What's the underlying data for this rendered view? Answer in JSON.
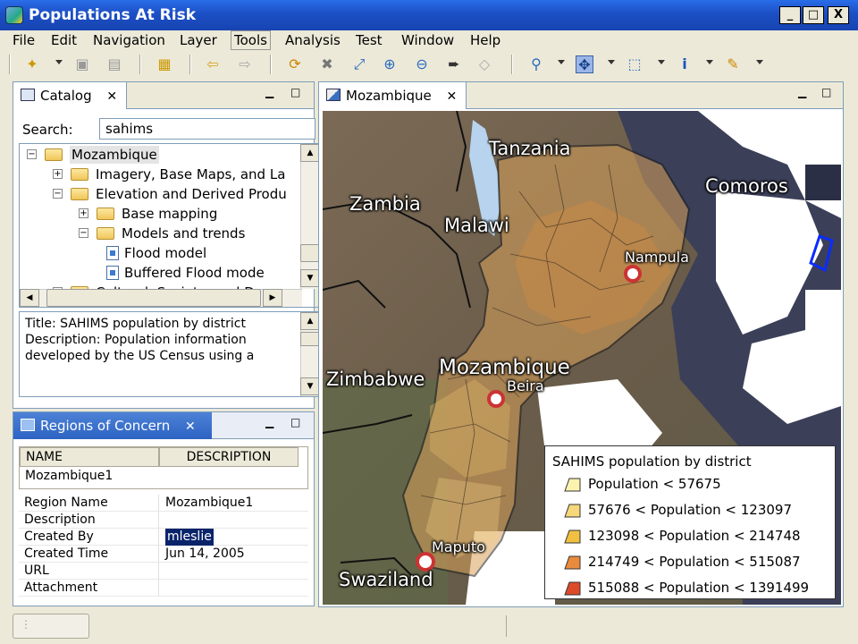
{
  "window": {
    "title": "Populations At Risk",
    "controls": [
      "_",
      "□",
      "X"
    ]
  },
  "menu": [
    "File",
    "Edit",
    "Navigation",
    "Layer",
    "Tools",
    "Analysis",
    "Test",
    "Window",
    "Help"
  ],
  "menu_active": "Tools",
  "catalog": {
    "tab_label": "Catalog",
    "search_label": "Search:",
    "search_value": "sahims",
    "tree": [
      {
        "label": "Mozambique",
        "level": 0,
        "type": "folder",
        "expanded": true,
        "selected": true
      },
      {
        "label": "Imagery, Base Maps, and La",
        "level": 1,
        "type": "folder",
        "expanded": false
      },
      {
        "label": "Elevation and Derived Produ",
        "level": 1,
        "type": "folder",
        "expanded": true
      },
      {
        "label": "Base mapping",
        "level": 2,
        "type": "folder",
        "expanded": false
      },
      {
        "label": "Models and trends",
        "level": 2,
        "type": "folder",
        "expanded": true
      },
      {
        "label": "Flood model",
        "level": 3,
        "type": "file"
      },
      {
        "label": "Buffered Flood mode",
        "level": 3,
        "type": "file"
      },
      {
        "label": "Cultural, Society, and Demo",
        "level": 1,
        "type": "folder",
        "expanded": true
      }
    ],
    "description_lines": [
      "Title: SAHIMS population by district",
      "Description: Population information",
      "developed by the US Census using a"
    ]
  },
  "regions": {
    "tab_label": "Regions of Concern",
    "columns": [
      "NAME",
      "DESCRIPTION"
    ],
    "rows": [
      {
        "name": "Mozambique1",
        "description": ""
      }
    ],
    "properties": [
      {
        "key": "Region Name",
        "value": "Mozambique1"
      },
      {
        "key": "Description",
        "value": ""
      },
      {
        "key": "Created By",
        "value": "mleslie",
        "selected": true
      },
      {
        "key": "Created Time",
        "value": "Jun 14, 2005"
      },
      {
        "key": "URL",
        "value": ""
      },
      {
        "key": "Attachment",
        "value": ""
      }
    ]
  },
  "map": {
    "tab_label": "Mozambique",
    "labels": {
      "tanzania": "Tanzania",
      "zambia": "Zambia",
      "malawi": "Malawi",
      "comoros": "Comoros",
      "nampula": "Nampula",
      "zimbabwe": "Zimbabwe",
      "mozambique": "Mozambique",
      "beira": "Beira",
      "maputo": "Maputo",
      "swaziland": "Swaziland"
    },
    "legend": {
      "title": "SAHIMS population by district",
      "items": [
        {
          "label": "Population < 57675",
          "color": "#fbf3b0"
        },
        {
          "label": "57676 < Population < 123097",
          "color": "#f6d77a"
        },
        {
          "label": "123098 < Population < 214748",
          "color": "#f2c040"
        },
        {
          "label": "214749 < Population < 515087",
          "color": "#e98b3c"
        },
        {
          "label": "515088 < Population < 1391499",
          "color": "#dc4a2a"
        }
      ]
    }
  }
}
